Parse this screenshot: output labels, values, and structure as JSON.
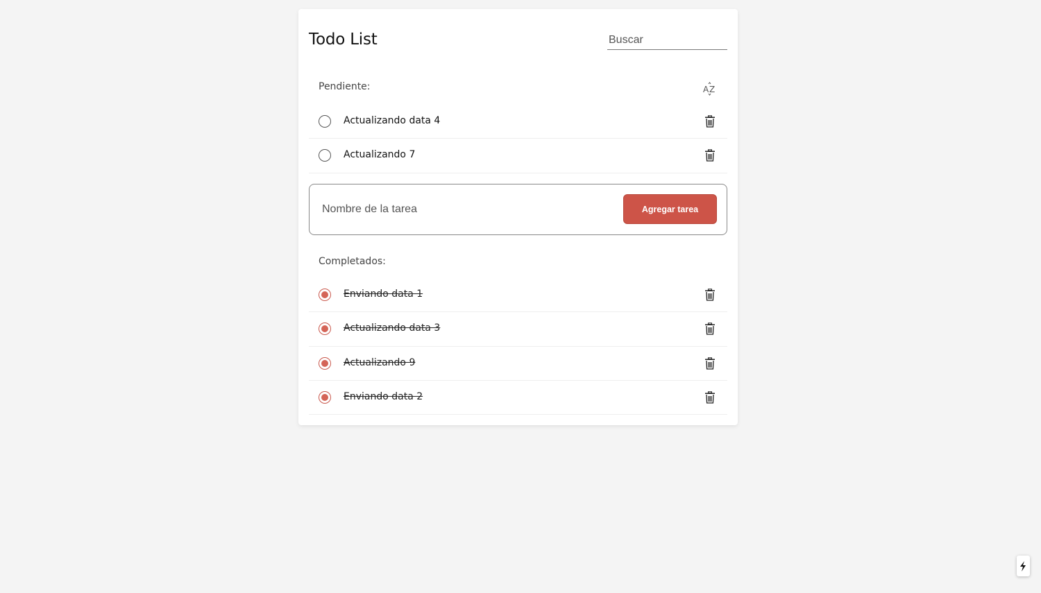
{
  "header": {
    "title": "Todo List",
    "search_placeholder": "Buscar"
  },
  "pending": {
    "label": "Pendiente:",
    "sort_icon": "sort-alpha-icon",
    "items": [
      {
        "text": "Actualizando data 4",
        "completed": false
      },
      {
        "text": "Actualizando 7",
        "completed": false
      }
    ]
  },
  "add_task": {
    "input_placeholder": "Nombre de la tarea",
    "button_label": "Agregar tarea"
  },
  "completed": {
    "label": "Completados:",
    "items": [
      {
        "text": "Enviando data 1",
        "completed": true
      },
      {
        "text": "Actualizando data 3",
        "completed": true
      },
      {
        "text": "Actualizando 9",
        "completed": true
      },
      {
        "text": "Enviando data 2",
        "completed": true
      }
    ]
  },
  "colors": {
    "accent": "#cd5448",
    "background": "#f4f4f4",
    "card": "#ffffff"
  },
  "icons": {
    "delete": "trash-icon",
    "sort": "sort-alpha-icon",
    "dev_indicator": "lightning-bolt-icon"
  }
}
